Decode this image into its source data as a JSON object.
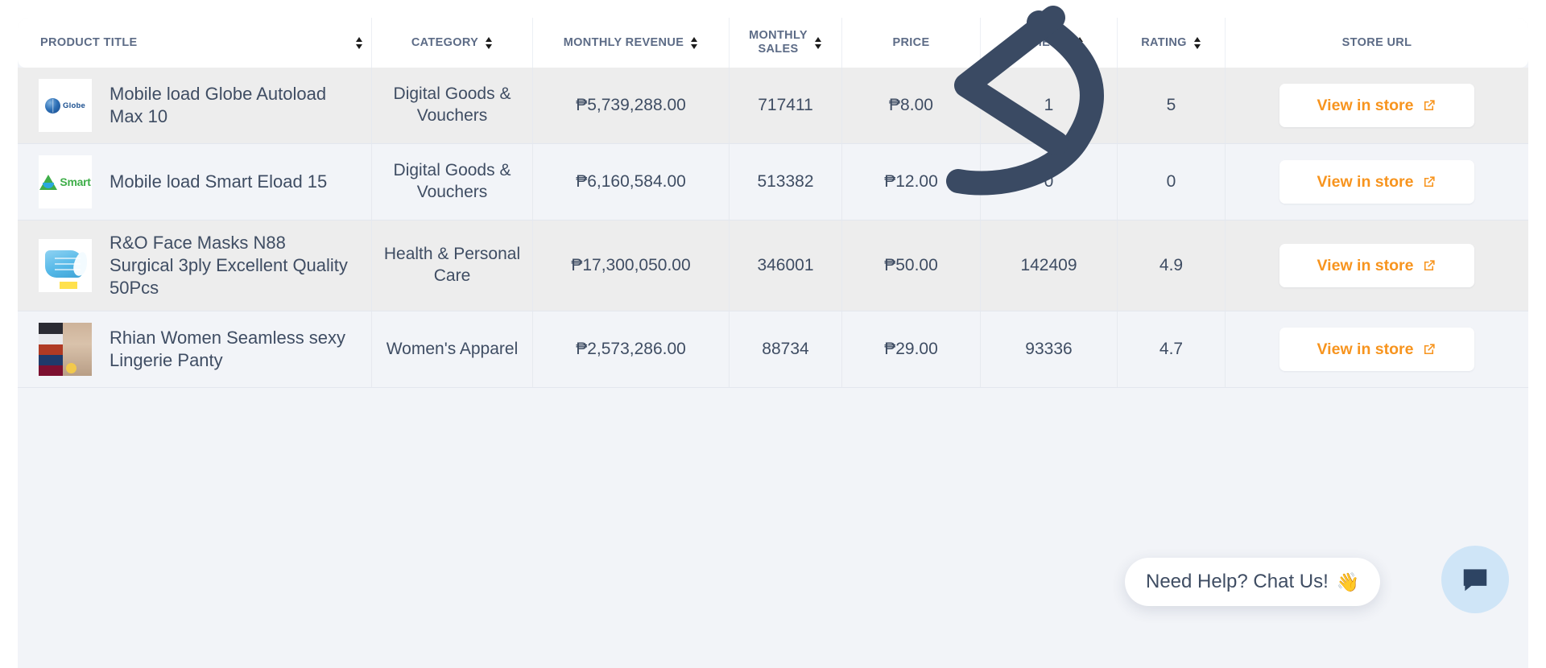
{
  "table": {
    "columns": [
      {
        "key": "title",
        "label": "PRODUCT TITLE",
        "sortable": true,
        "align": "left"
      },
      {
        "key": "category",
        "label": "CATEGORY",
        "sortable": true,
        "align": "center"
      },
      {
        "key": "revenue",
        "label": "MONTHLY REVENUE",
        "sortable": true,
        "align": "center"
      },
      {
        "key": "sales",
        "label": "MONTHLY\nSALES",
        "sortable": true,
        "align": "center"
      },
      {
        "key": "price",
        "label": "PRICE",
        "sortable": false,
        "align": "center"
      },
      {
        "key": "reviews",
        "label": "REVIEWS",
        "sortable": true,
        "align": "center"
      },
      {
        "key": "rating",
        "label": "RATING",
        "sortable": true,
        "align": "center"
      },
      {
        "key": "url",
        "label": "STORE URL",
        "sortable": false,
        "align": "center"
      }
    ],
    "rows": [
      {
        "thumb": "globe-logo",
        "title": "Mobile load Globe Autoload Max 10",
        "category": "Digital Goods & Vouchers",
        "revenue": "₱5,739,288.00",
        "sales": "717411",
        "price": "₱8.00",
        "reviews": "1",
        "rating": "5",
        "store_button": "View in store"
      },
      {
        "thumb": "smart-logo",
        "title": "Mobile load Smart Eload 15",
        "category": "Digital Goods & Vouchers",
        "revenue": "₱6,160,584.00",
        "sales": "513382",
        "price": "₱12.00",
        "reviews": "0",
        "rating": "0",
        "store_button": "View in store"
      },
      {
        "thumb": "face-mask-photo",
        "title": "R&O Face Masks N88 Surgical 3ply Excellent Quality 50Pcs",
        "category": "Health & Personal Care",
        "revenue": "₱17,300,050.00",
        "sales": "346001",
        "price": "₱50.00",
        "reviews": "142409",
        "rating": "4.9",
        "store_button": "View in store"
      },
      {
        "thumb": "lingerie-photo",
        "title": "Rhian Women Seamless sexy Lingerie Panty",
        "category": "Women's Apparel",
        "revenue": "₱2,573,286.00",
        "sales": "88734",
        "price": "₱29.00",
        "reviews": "93336",
        "rating": "4.7",
        "store_button": "View in store"
      }
    ]
  },
  "chat_widget": {
    "message": "Need Help? Chat Us!",
    "wave_emoji": "👋",
    "fab_icon": "chat-bubble-icon"
  },
  "annotation": {
    "type": "curved-left-arrow",
    "color": "#3a4a63"
  },
  "colors": {
    "accent_orange": "#f7941e",
    "header_text": "#5c6b86",
    "body_text": "#3f4d63",
    "row_odd_bg": "#ededed",
    "row_even_bg": "#f2f4f8",
    "page_bg": "#f2f4f8",
    "annotation": "#3a4a63",
    "chat_fab_bg": "#cfe5f7"
  }
}
